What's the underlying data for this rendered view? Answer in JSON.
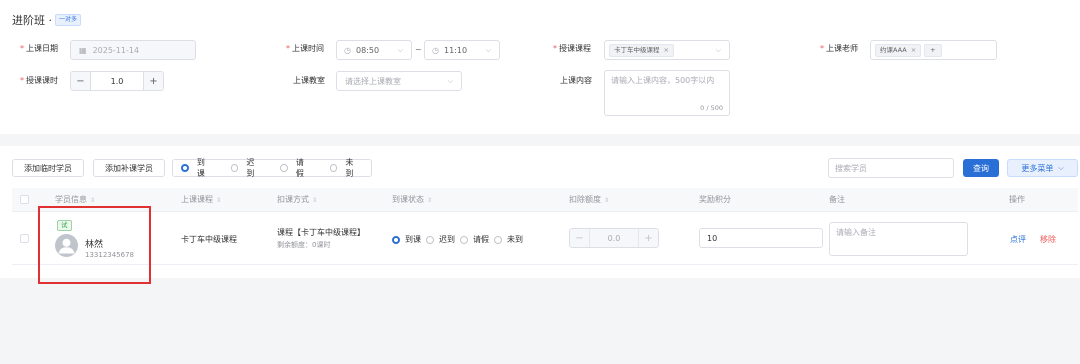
{
  "header": {
    "title": "进阶班 ·",
    "tag": "一对多"
  },
  "form": {
    "date_label": "上课日期",
    "date_value": "2025-11-14",
    "time_label": "上课时间",
    "time_start": "08:50",
    "time_sep": "~",
    "time_end": "11:10",
    "course_label": "授课课程",
    "course_chip": "卡丁车中级课程",
    "teacher_label": "上课老师",
    "teacher_chip": "约课AAA",
    "teacher_add": "+",
    "hours_label": "授课课时",
    "hours_value": "1.0",
    "hours_minus": "−",
    "hours_plus": "+",
    "room_label": "上课教室",
    "room_placeholder": "请选择上课教室",
    "content_label": "上课内容",
    "content_placeholder": "请输入上课内容，500字以内",
    "content_count": "0 / 500"
  },
  "toolbar": {
    "add_temp": "添加临时学员",
    "add_makeup": "添加补课学员",
    "radios": [
      "到课",
      "迟到",
      "请假",
      "未到"
    ],
    "search_placeholder": "搜索学员",
    "query": "查询",
    "more": "更多菜单"
  },
  "table": {
    "headers": {
      "student": "学员信息",
      "course": "上课课程",
      "deduct_method": "扣课方式",
      "status": "到课状态",
      "deduct_amount": "扣除额度",
      "points": "奖励积分",
      "remark": "备注",
      "action": "操作"
    },
    "row": {
      "trial": "试",
      "name": "林然",
      "phone": "13312345678",
      "course": "卡丁车中级课程",
      "deduct_title": "课程【卡丁车中级课程】",
      "deduct_sub": "剩余额度：0课时",
      "status_options": [
        "到课",
        "迟到",
        "请假",
        "未到"
      ],
      "amount_minus": "−",
      "amount_value": "0.0",
      "amount_plus": "+",
      "points": "10",
      "remark_placeholder": "请输入备注",
      "review": "点评",
      "remove": "移除"
    }
  },
  "colors": {
    "primary": "#2a6fd6",
    "danger": "#f05a5a",
    "trial": "#37a84a",
    "highlight": "#e0302f"
  }
}
